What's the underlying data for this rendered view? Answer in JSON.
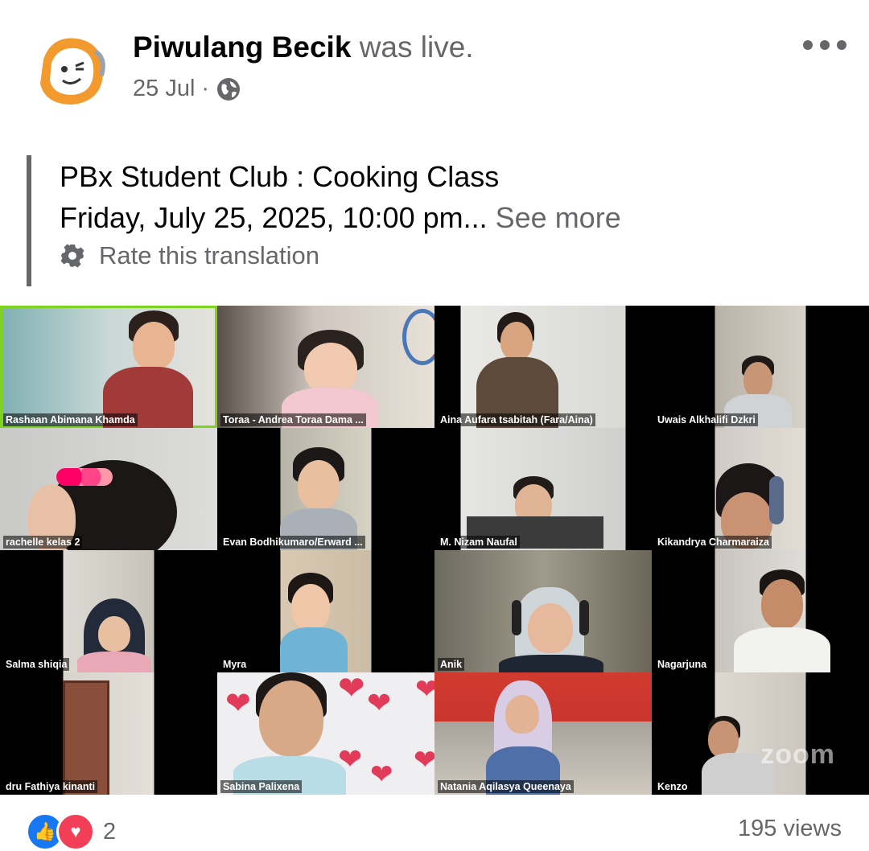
{
  "post": {
    "page_name": "Piwulang Becik",
    "status": "was live.",
    "date": "25 Jul",
    "separator": "·",
    "privacy_icon": "globe-icon",
    "more_icon": "more-options-icon"
  },
  "text": {
    "line1": "PBx Student Club : Cooking Class",
    "line2": "Friday, July 25, 2025, 10:00 pm...",
    "see_more": "See more",
    "rate_translation": "Rate this translation"
  },
  "video": {
    "watermark": "zoom",
    "participants": [
      "Rashaan Abimana Khamda",
      "Toraa - Andrea Toraa Dama ...",
      "Aina Aufara tsabitah (Fara/Aina)",
      "Uwais Alkhalifi Dzkri",
      "rachelle kelas 2",
      "Evan Bodhikumaro/Erward ...",
      "M. Nizam Naufal",
      "Kikandrya Charmaraiza",
      "Salma shiqia",
      "Myra",
      "Anik",
      "Nagarjuna",
      "dru Fathiya kinanti",
      "Sabina Palixena",
      "Natania Aqilasya Queenaya",
      "Kenzo"
    ]
  },
  "footer": {
    "reaction_count": "2",
    "views": "195 views"
  },
  "colors": {
    "secondary_text": "#65676b",
    "like_blue": "#1877f2",
    "love_red": "#f33e58",
    "active_speaker": "#7ed321"
  }
}
